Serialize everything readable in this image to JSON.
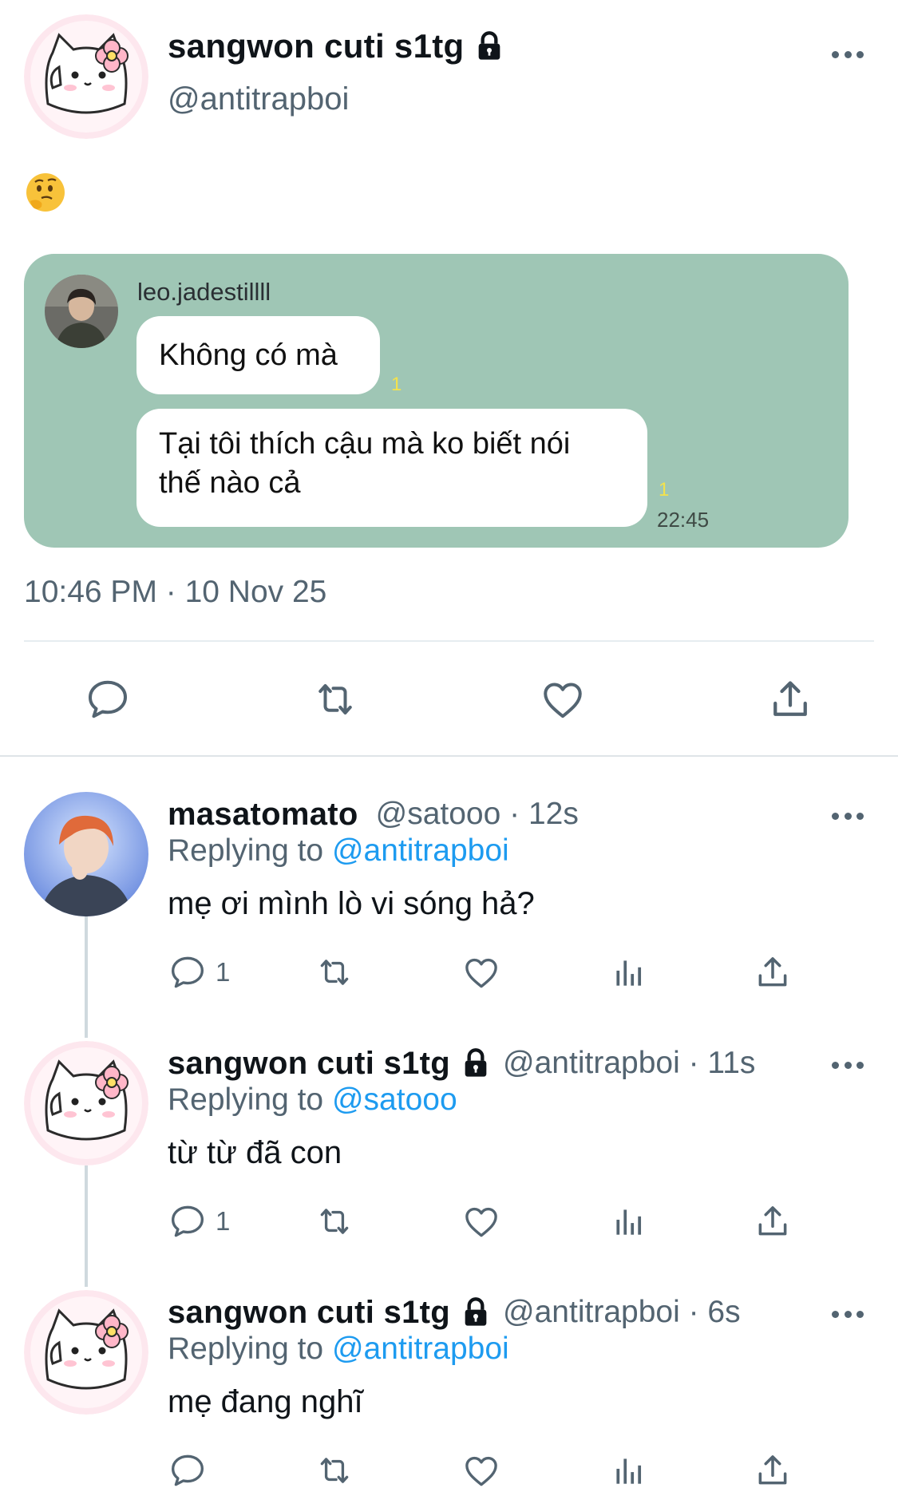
{
  "main_tweet": {
    "author_name": "sangwon cuti s1tg",
    "author_handle": "@antitrapboi",
    "emoji": "🤔",
    "embedded_chat": {
      "sender": "leo.jadestillll",
      "messages": [
        {
          "text": "Không có mà",
          "read_count": "1"
        },
        {
          "text_line1": "Tại tôi thích cậu mà ko biết nói",
          "text_line2": "thế nào cả",
          "read_count": "1",
          "time": "22:45"
        }
      ]
    },
    "timestamp": "10:46 PM · 10 Nov 25",
    "actions": [
      "reply-icon",
      "retweet-icon",
      "like-icon",
      "share-icon"
    ]
  },
  "replies": [
    {
      "name": "masatomato",
      "handle": "@satooo",
      "time": "12s",
      "replying_prefix": "Replying to",
      "replying_to": "@antitrapboi",
      "text": "mẹ ơi mình lò vi sóng hả?",
      "reply_count": "1",
      "locked": false
    },
    {
      "name": "sangwon cuti s1tg",
      "handle": "@antitrapboi",
      "time": "11s",
      "replying_prefix": "Replying to",
      "replying_to": "@satooo",
      "text": "từ từ đã con",
      "reply_count": "1",
      "locked": true
    },
    {
      "name": "sangwon cuti s1tg",
      "handle": "@antitrapboi",
      "time": "6s",
      "replying_prefix": "Replying to",
      "replying_to": "@antitrapboi",
      "text": "mẹ đang nghĩ",
      "reply_count": "",
      "locked": true
    }
  ],
  "colors": {
    "embed_background": "#9fc6b5",
    "mention": "#1d9bf0",
    "secondary_text": "#536471",
    "read_receipt": "#f4e24b"
  }
}
